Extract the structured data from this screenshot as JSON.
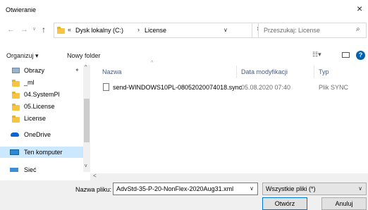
{
  "window": {
    "title": "Otwieranie",
    "close_glyph": "×"
  },
  "address": {
    "prefix": "«",
    "crumbs": [
      "Dysk lokalny (C:)",
      "License"
    ],
    "separator": "›"
  },
  "search": {
    "placeholder": "Przeszukaj: License"
  },
  "toolbar": {
    "organize_label": "Organizuj ▾",
    "new_folder_label": "Nowy folder",
    "help_glyph": "?"
  },
  "sidebar": {
    "items": [
      {
        "label": "Obrazy"
      },
      {
        "label": "_ml"
      },
      {
        "label": "04.SystemPl"
      },
      {
        "label": "05.License"
      },
      {
        "label": "License"
      },
      {
        "label": "OneDrive"
      },
      {
        "label": "Ten komputer"
      },
      {
        "label": "Sieć"
      }
    ]
  },
  "table": {
    "headers": [
      "Nazwa",
      "Data modyfikacji",
      "Typ"
    ],
    "rows": [
      {
        "name": "send-WINDOWS10PL-08052020074018.sync",
        "date": "05.08.2020 07:40",
        "type": "Plik SYNC"
      }
    ]
  },
  "footer": {
    "filename_label": "Nazwa pliku:",
    "filename_value": "AdvStd-35-P-20-NonFlex-2020Aug31.xml",
    "filetype_value": "Wszystkie pliki (*)",
    "open_label": "Otwórz",
    "cancel_label": "Anuluj"
  },
  "colors": {
    "accent": "#0078d7",
    "folder": "#f5c542",
    "selected_bg": "#cce8ff"
  }
}
